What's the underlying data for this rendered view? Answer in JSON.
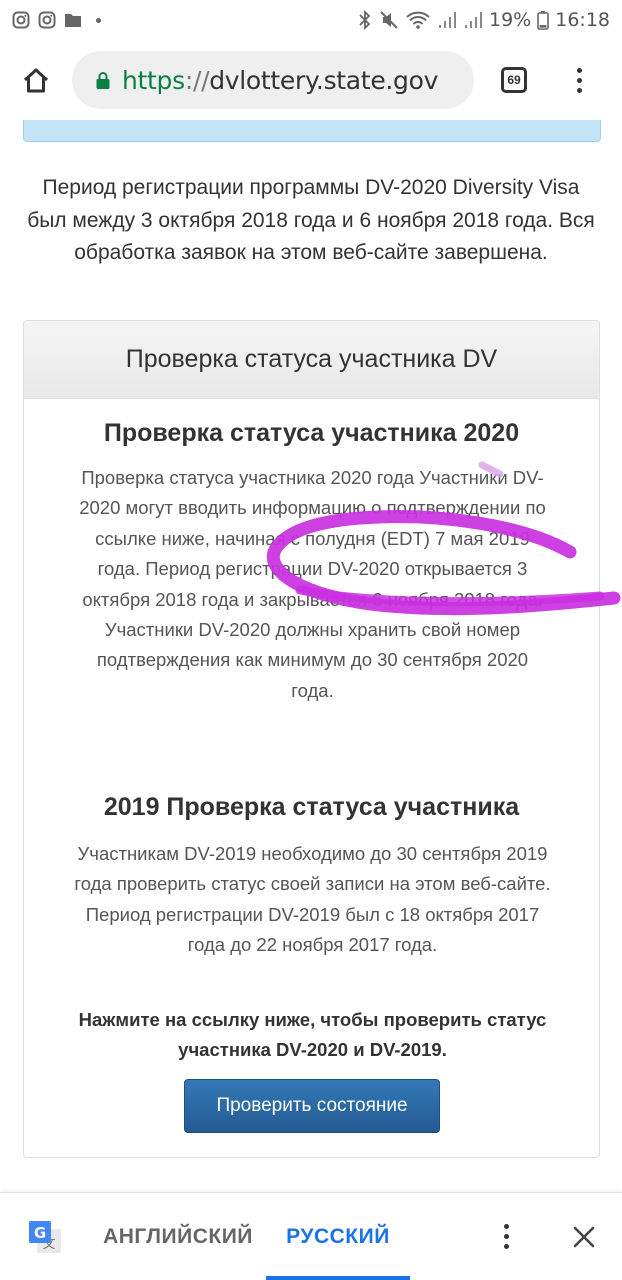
{
  "status_bar": {
    "battery": "19%",
    "time": "16:18"
  },
  "browser": {
    "url_scheme": "https",
    "url_separator": "://",
    "url_host": "dvlottery.state.gov",
    "tab_count": "69"
  },
  "page": {
    "intro": "Период регистрации программы DV-2020 Diversity Visa был между 3 октября 2018 года и 6 ноября 2018 года. Вся обработка заявок на этом веб-сайте завершена.",
    "panel_heading": "Проверка статуса участника DV",
    "section1_title": "Проверка статуса участника 2020",
    "section1_text": "Проверка статуса участника 2020 года Участники DV-2020 могут вводить информацию о подтверждении по ссылке ниже, начиная с полудня (EDT) 7 мая 2019 года. Период регистрации DV-2020 открывается 3 октября 2018 года и закрывается 6 ноября 2018 года. Участники DV-2020 должны хранить свой номер подтверждения как минимум до 30 сентября 2020 года.",
    "section2_title": "2019 Проверка статуса участника",
    "section2_text": "Участникам DV-2019 необходимо до 30 сентября 2019 года проверить статус своей записи на этом веб-сайте. Период регистрации DV-2019 был с 18 октября 2017 года до 22 ноября 2017 года.",
    "section2_bold": "Нажмите на ссылку ниже, чтобы проверить статус участника DV-2020 и DV-2019.",
    "check_button": "Проверить состояние"
  },
  "translate_bar": {
    "lang_source": "АНГЛИЙСКИЙ",
    "lang_target": "РУССКИЙ"
  },
  "colors": {
    "url_scheme": "#0b8043",
    "button": "#2a6aa6",
    "scribble": "#c930e0",
    "translate_active": "#1a73e8"
  }
}
